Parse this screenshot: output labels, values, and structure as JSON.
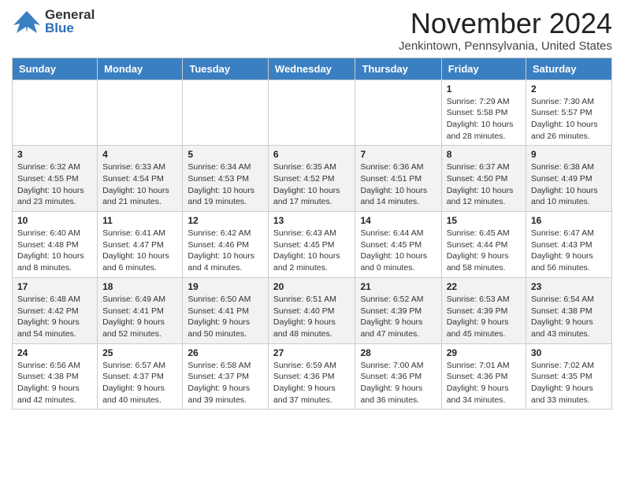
{
  "header": {
    "logo_general": "General",
    "logo_blue": "Blue",
    "title": "November 2024",
    "location": "Jenkintown, Pennsylvania, United States"
  },
  "days_of_week": [
    "Sunday",
    "Monday",
    "Tuesday",
    "Wednesday",
    "Thursday",
    "Friday",
    "Saturday"
  ],
  "weeks": [
    [
      {
        "day": "",
        "info": ""
      },
      {
        "day": "",
        "info": ""
      },
      {
        "day": "",
        "info": ""
      },
      {
        "day": "",
        "info": ""
      },
      {
        "day": "",
        "info": ""
      },
      {
        "day": "1",
        "info": "Sunrise: 7:29 AM\nSunset: 5:58 PM\nDaylight: 10 hours and 28 minutes."
      },
      {
        "day": "2",
        "info": "Sunrise: 7:30 AM\nSunset: 5:57 PM\nDaylight: 10 hours and 26 minutes."
      }
    ],
    [
      {
        "day": "3",
        "info": "Sunrise: 6:32 AM\nSunset: 4:55 PM\nDaylight: 10 hours and 23 minutes."
      },
      {
        "day": "4",
        "info": "Sunrise: 6:33 AM\nSunset: 4:54 PM\nDaylight: 10 hours and 21 minutes."
      },
      {
        "day": "5",
        "info": "Sunrise: 6:34 AM\nSunset: 4:53 PM\nDaylight: 10 hours and 19 minutes."
      },
      {
        "day": "6",
        "info": "Sunrise: 6:35 AM\nSunset: 4:52 PM\nDaylight: 10 hours and 17 minutes."
      },
      {
        "day": "7",
        "info": "Sunrise: 6:36 AM\nSunset: 4:51 PM\nDaylight: 10 hours and 14 minutes."
      },
      {
        "day": "8",
        "info": "Sunrise: 6:37 AM\nSunset: 4:50 PM\nDaylight: 10 hours and 12 minutes."
      },
      {
        "day": "9",
        "info": "Sunrise: 6:38 AM\nSunset: 4:49 PM\nDaylight: 10 hours and 10 minutes."
      }
    ],
    [
      {
        "day": "10",
        "info": "Sunrise: 6:40 AM\nSunset: 4:48 PM\nDaylight: 10 hours and 8 minutes."
      },
      {
        "day": "11",
        "info": "Sunrise: 6:41 AM\nSunset: 4:47 PM\nDaylight: 10 hours and 6 minutes."
      },
      {
        "day": "12",
        "info": "Sunrise: 6:42 AM\nSunset: 4:46 PM\nDaylight: 10 hours and 4 minutes."
      },
      {
        "day": "13",
        "info": "Sunrise: 6:43 AM\nSunset: 4:45 PM\nDaylight: 10 hours and 2 minutes."
      },
      {
        "day": "14",
        "info": "Sunrise: 6:44 AM\nSunset: 4:45 PM\nDaylight: 10 hours and 0 minutes."
      },
      {
        "day": "15",
        "info": "Sunrise: 6:45 AM\nSunset: 4:44 PM\nDaylight: 9 hours and 58 minutes."
      },
      {
        "day": "16",
        "info": "Sunrise: 6:47 AM\nSunset: 4:43 PM\nDaylight: 9 hours and 56 minutes."
      }
    ],
    [
      {
        "day": "17",
        "info": "Sunrise: 6:48 AM\nSunset: 4:42 PM\nDaylight: 9 hours and 54 minutes."
      },
      {
        "day": "18",
        "info": "Sunrise: 6:49 AM\nSunset: 4:41 PM\nDaylight: 9 hours and 52 minutes."
      },
      {
        "day": "19",
        "info": "Sunrise: 6:50 AM\nSunset: 4:41 PM\nDaylight: 9 hours and 50 minutes."
      },
      {
        "day": "20",
        "info": "Sunrise: 6:51 AM\nSunset: 4:40 PM\nDaylight: 9 hours and 48 minutes."
      },
      {
        "day": "21",
        "info": "Sunrise: 6:52 AM\nSunset: 4:39 PM\nDaylight: 9 hours and 47 minutes."
      },
      {
        "day": "22",
        "info": "Sunrise: 6:53 AM\nSunset: 4:39 PM\nDaylight: 9 hours and 45 minutes."
      },
      {
        "day": "23",
        "info": "Sunrise: 6:54 AM\nSunset: 4:38 PM\nDaylight: 9 hours and 43 minutes."
      }
    ],
    [
      {
        "day": "24",
        "info": "Sunrise: 6:56 AM\nSunset: 4:38 PM\nDaylight: 9 hours and 42 minutes."
      },
      {
        "day": "25",
        "info": "Sunrise: 6:57 AM\nSunset: 4:37 PM\nDaylight: 9 hours and 40 minutes."
      },
      {
        "day": "26",
        "info": "Sunrise: 6:58 AM\nSunset: 4:37 PM\nDaylight: 9 hours and 39 minutes."
      },
      {
        "day": "27",
        "info": "Sunrise: 6:59 AM\nSunset: 4:36 PM\nDaylight: 9 hours and 37 minutes."
      },
      {
        "day": "28",
        "info": "Sunrise: 7:00 AM\nSunset: 4:36 PM\nDaylight: 9 hours and 36 minutes."
      },
      {
        "day": "29",
        "info": "Sunrise: 7:01 AM\nSunset: 4:36 PM\nDaylight: 9 hours and 34 minutes."
      },
      {
        "day": "30",
        "info": "Sunrise: 7:02 AM\nSunset: 4:35 PM\nDaylight: 9 hours and 33 minutes."
      }
    ]
  ]
}
